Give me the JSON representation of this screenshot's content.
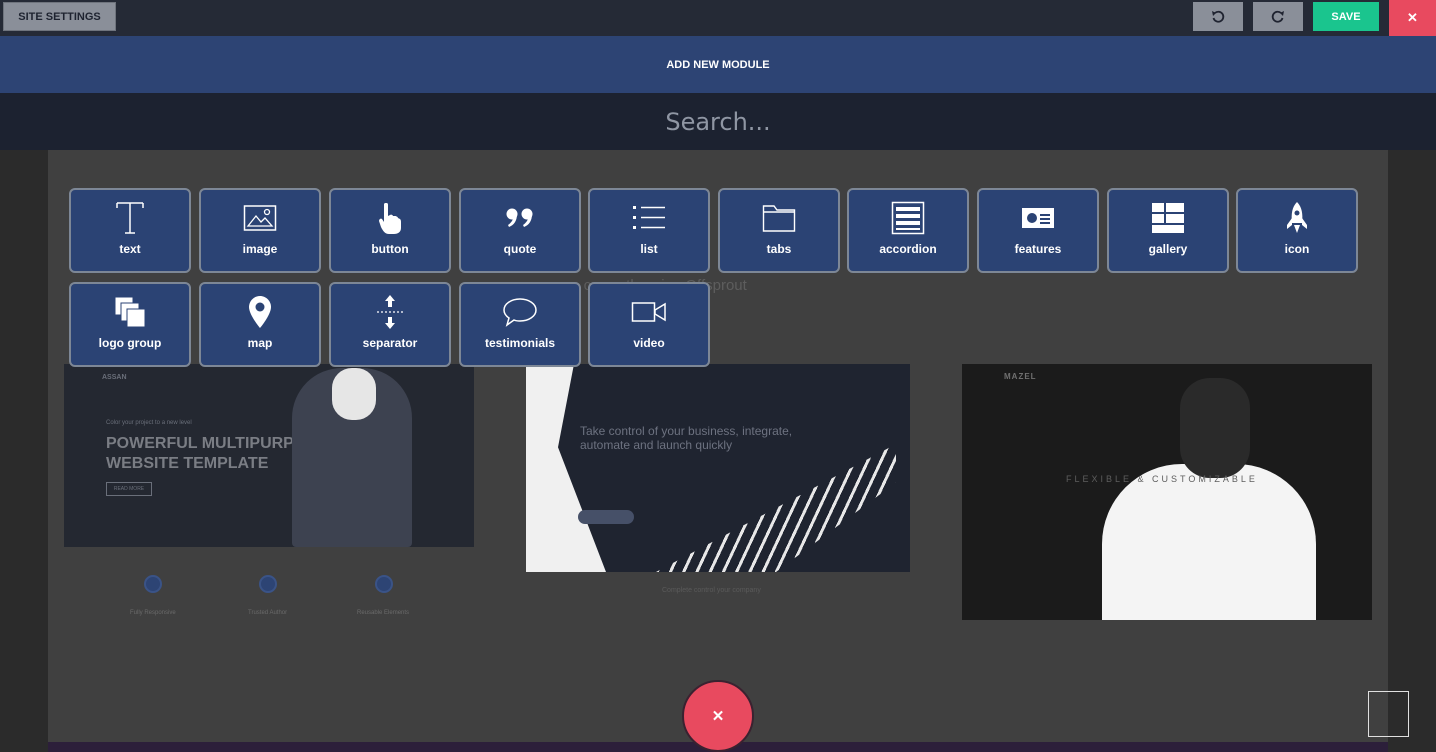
{
  "topbar": {
    "site_settings": "SITE SETTINGS",
    "save": "SAVE",
    "close": "✕"
  },
  "header": {
    "title": "ADD NEW MODULE"
  },
  "search": {
    "placeholder": "Search..."
  },
  "background": {
    "subtitle": "s currently using Offsprout",
    "thumb1": {
      "nav": "ASSAN",
      "small": "Color your project to a new level",
      "title": "POWERFUL MULTIPURPOSE WEBSITE TEMPLATE",
      "button": "READ MORE"
    },
    "thumb2": {
      "text": "Take control of your business, integrate, automate and launch quickly"
    },
    "thumb3": {
      "nav": "MAZEL",
      "text": "FLEXIBLE & CUSTOMIZABLE"
    },
    "features": [
      "Fully Responsive",
      "Trusted Author",
      "Reusable Elements"
    ],
    "caption": "Complete control your company"
  },
  "modules": [
    {
      "label": "text",
      "icon": "text-icon"
    },
    {
      "label": "image",
      "icon": "image-icon"
    },
    {
      "label": "button",
      "icon": "hand-pointer-icon"
    },
    {
      "label": "quote",
      "icon": "quote-icon"
    },
    {
      "label": "list",
      "icon": "list-icon"
    },
    {
      "label": "tabs",
      "icon": "folder-icon"
    },
    {
      "label": "accordion",
      "icon": "accordion-icon"
    },
    {
      "label": "features",
      "icon": "feature-card-icon"
    },
    {
      "label": "gallery",
      "icon": "gallery-icon"
    },
    {
      "label": "icon",
      "icon": "rocket-icon"
    },
    {
      "label": "logo group",
      "icon": "logo-group-icon"
    },
    {
      "label": "map",
      "icon": "map-pin-icon"
    },
    {
      "label": "separator",
      "icon": "separator-icon"
    },
    {
      "label": "testimonials",
      "icon": "speech-bubble-icon"
    },
    {
      "label": "video",
      "icon": "video-camera-icon"
    }
  ],
  "fab": {
    "close": "✕"
  },
  "colors": {
    "accent_blue": "#2b4374",
    "save_green": "#1ac58e",
    "close_red": "#e84a5f"
  }
}
